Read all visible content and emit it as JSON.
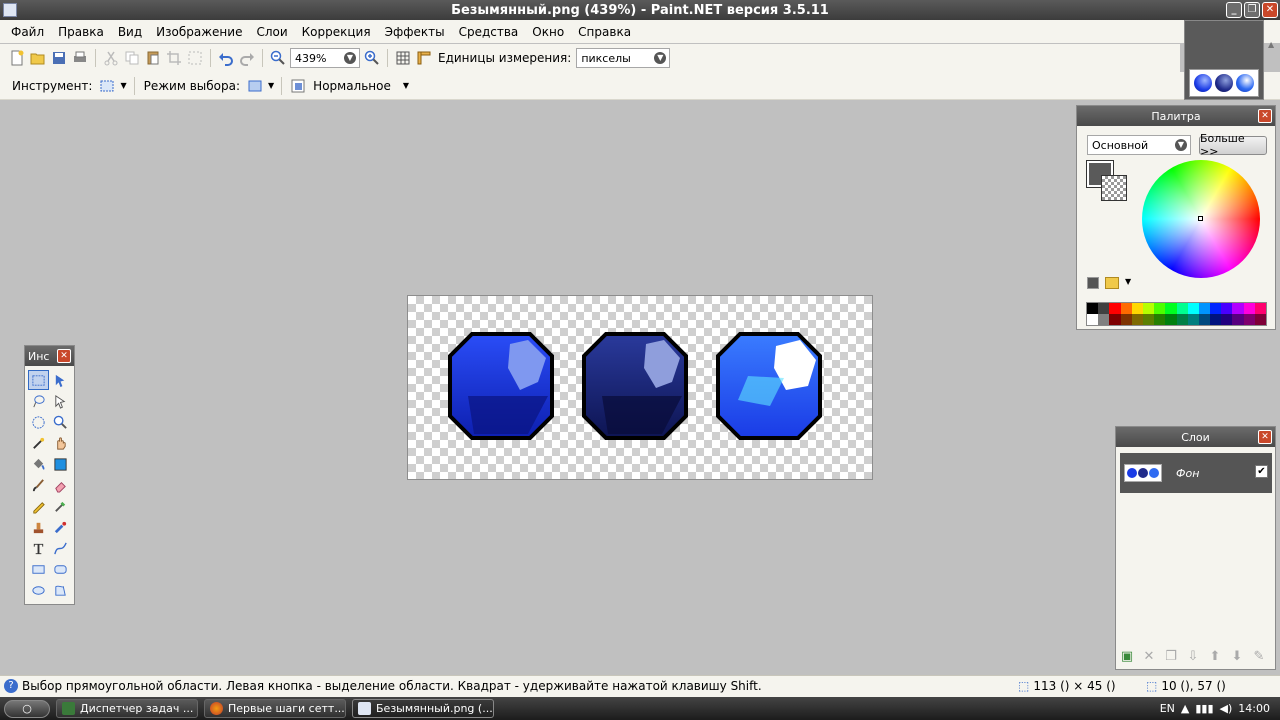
{
  "window": {
    "title": "Безымянный.png (439%) - Paint.NET версия 3.5.11"
  },
  "menu": [
    "Файл",
    "Правка",
    "Вид",
    "Изображение",
    "Слои",
    "Коррекция",
    "Эффекты",
    "Средства",
    "Окно",
    "Справка"
  ],
  "toolbar": {
    "zoom_value": "439%",
    "units_label": "Единицы измерения:",
    "units_value": "пикселы"
  },
  "toolbar2": {
    "tool_label": "Инструмент:",
    "mode_label": "Режим выбора:",
    "blend_value": "Нормальное"
  },
  "palette": {
    "title": "Палитра",
    "preset": "Основной",
    "more_button": "Больше >>",
    "primary_color": "#5a5a5a"
  },
  "tools_window": {
    "title": "Инс"
  },
  "layers": {
    "title": "Слои",
    "items": [
      {
        "name": "Фон",
        "visible": true
      }
    ]
  },
  "status": {
    "message": "Выбор прямоугольной области. Левая кнопка - выделение области. Квадрат - удерживайте нажатой клавишу Shift.",
    "size": "113 () × 45 ()",
    "position": "10 (), 57 ()"
  },
  "taskbar": {
    "items": [
      "Диспетчер задач ...",
      "Первые шаги сетт...",
      "Безымянный.png (..."
    ],
    "lang": "EN",
    "time": "14:00"
  },
  "colors": {
    "gem1": "#1a3be6",
    "gem2": "#1f2a8a",
    "gem3": "#2f6bf2",
    "accent": "#316ac5"
  }
}
